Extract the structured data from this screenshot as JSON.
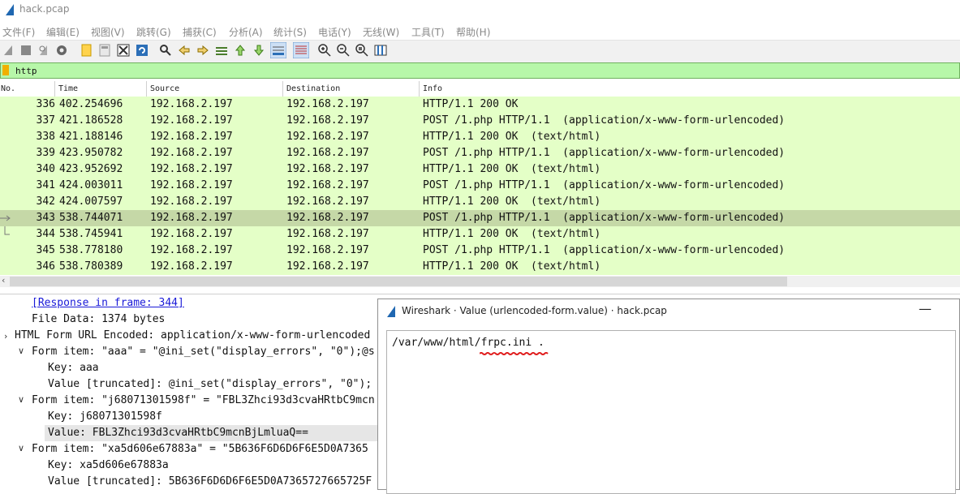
{
  "window": {
    "title": "hack.pcap"
  },
  "menu": [
    "文件(F)",
    "编辑(E)",
    "视图(V)",
    "跳转(G)",
    "捕获(C)",
    "分析(A)",
    "统计(S)",
    "电话(Y)",
    "无线(W)",
    "工具(T)",
    "帮助(H)"
  ],
  "filter": {
    "value": "http"
  },
  "columns": [
    "No.",
    "Time",
    "Source",
    "Destination",
    "Info"
  ],
  "packets": [
    {
      "no": "336",
      "time": "402.254696",
      "src": "192.168.2.197",
      "dst": "192.168.2.197",
      "info": "HTTP/1.1 200 OK"
    },
    {
      "no": "337",
      "time": "421.186528",
      "src": "192.168.2.197",
      "dst": "192.168.2.197",
      "info": "POST /1.php HTTP/1.1  (application/x-www-form-urlencoded)"
    },
    {
      "no": "338",
      "time": "421.188146",
      "src": "192.168.2.197",
      "dst": "192.168.2.197",
      "info": "HTTP/1.1 200 OK  (text/html)"
    },
    {
      "no": "339",
      "time": "423.950782",
      "src": "192.168.2.197",
      "dst": "192.168.2.197",
      "info": "POST /1.php HTTP/1.1  (application/x-www-form-urlencoded)"
    },
    {
      "no": "340",
      "time": "423.952692",
      "src": "192.168.2.197",
      "dst": "192.168.2.197",
      "info": "HTTP/1.1 200 OK  (text/html)"
    },
    {
      "no": "341",
      "time": "424.003011",
      "src": "192.168.2.197",
      "dst": "192.168.2.197",
      "info": "POST /1.php HTTP/1.1  (application/x-www-form-urlencoded)"
    },
    {
      "no": "342",
      "time": "424.007597",
      "src": "192.168.2.197",
      "dst": "192.168.2.197",
      "info": "HTTP/1.1 200 OK  (text/html)"
    },
    {
      "no": "343",
      "time": "538.744071",
      "src": "192.168.2.197",
      "dst": "192.168.2.197",
      "info": "POST /1.php HTTP/1.1  (application/x-www-form-urlencoded)"
    },
    {
      "no": "344",
      "time": "538.745941",
      "src": "192.168.2.197",
      "dst": "192.168.2.197",
      "info": "HTTP/1.1 200 OK  (text/html)"
    },
    {
      "no": "345",
      "time": "538.778180",
      "src": "192.168.2.197",
      "dst": "192.168.2.197",
      "info": "POST /1.php HTTP/1.1  (application/x-www-form-urlencoded)"
    },
    {
      "no": "346",
      "time": "538.780389",
      "src": "192.168.2.197",
      "dst": "192.168.2.197",
      "info": "HTTP/1.1 200 OK  (text/html)"
    }
  ],
  "details": {
    "response_link": "[Response in frame: 344]",
    "file_data": "File Data: 1374 bytes",
    "html_form": "HTML Form URL Encoded: application/x-www-form-urlencoded",
    "item1": "Form item: \"aaa\" = \"@ini_set(\"display_errors\", \"0\");@s",
    "item1_key": "Key: aaa",
    "item1_value": "Value [truncated]: @ini_set(\"display_errors\", \"0\");",
    "item2": "Form item: \"j68071301598f\" = \"FBL3Zhci93d3cvaHRtbC9mcn",
    "item2_key": "Key: j68071301598f",
    "item2_value": "Value: FBL3Zhci93d3cvaHRtbC9mcnBjLmluaQ==",
    "item3": "Form item: \"xa5d606e67883a\" = \"5B636F6D6D6F6E5D0A7365",
    "item3_key": "Key: xa5d606e67883a",
    "item3_value": "Value [truncated]: 5B636F6D6D6F6E5D0A7365727665725F"
  },
  "dialog": {
    "title": "Wireshark · Value (urlencoded-form.value) · hack.pcap",
    "content": "/var/www/html/frpc.ini .",
    "minimize": "—"
  },
  "colors": {
    "row_bg": "#e4ffc7",
    "row_selected": "#c5d8a7",
    "filter_bg": "#b7f7a9",
    "annotation": "#e02020"
  }
}
